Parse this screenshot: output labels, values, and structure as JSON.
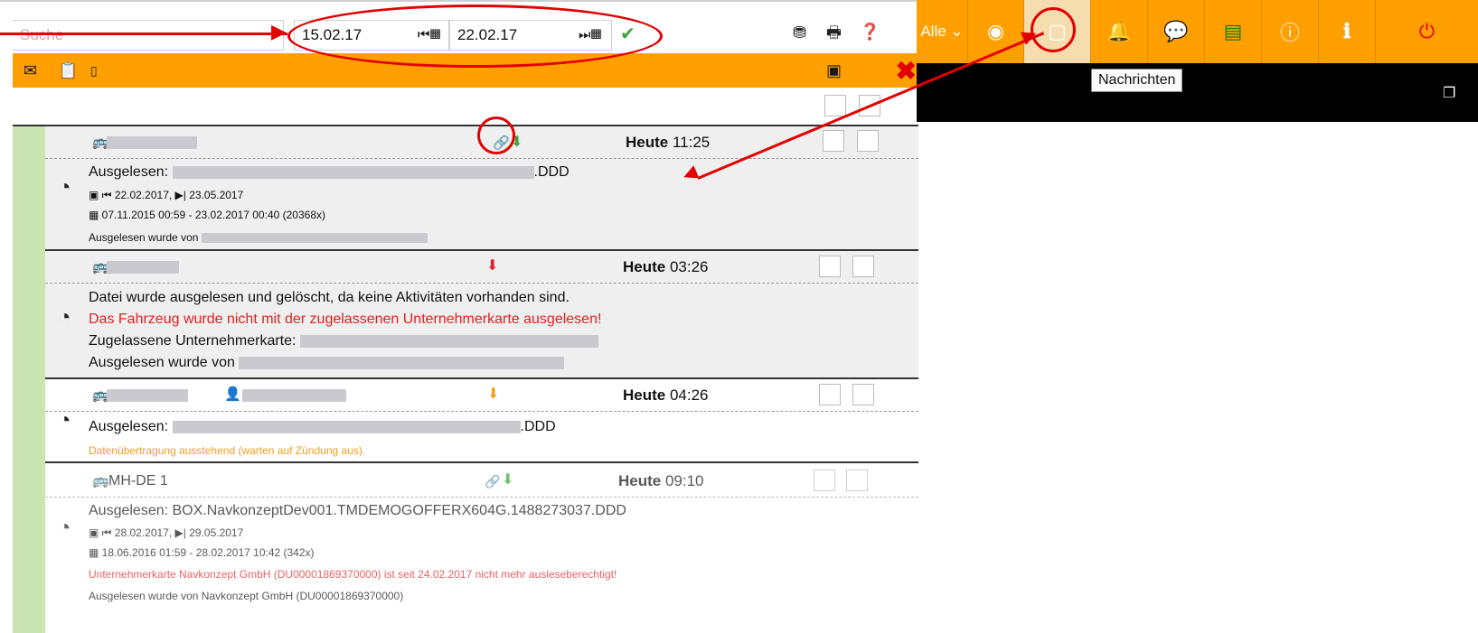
{
  "toolbar": {
    "search_placeholder": "Suche",
    "date_from": "15.02.17",
    "date_to": "22.02.17",
    "icons": [
      "first-page-calendar-icon",
      "last-page-calendar-icon",
      "checkmark-icon",
      "filter-icon",
      "print-icon",
      "help-icon"
    ]
  },
  "actionbar": {
    "icons": [
      "email-icon",
      "clipboard-icon",
      "mobile-icon",
      "archive-icon",
      "close-icon"
    ],
    "close_glyph": "✖"
  },
  "appbar": {
    "filter_label": "Alle ⌄",
    "tooltip": "Nachrichten",
    "cells": [
      "globe-icon",
      "messages-icon",
      "bell-icon",
      "chat-icon",
      "card-icon",
      "help-circle-icon",
      "info-icon",
      "power-icon"
    ]
  },
  "messages": [
    {
      "time_prefix": "Heute",
      "time": "11:25",
      "line1_prefix": "Ausgelesen:",
      "line1_suffix": ".DDD",
      "line2": "22.02.2017, ▶| 23.05.2017",
      "line3": "07.11.2015 00:59 - 23.02.2017 00:40 (20368x)",
      "line4_prefix": "Ausgelesen wurde von"
    },
    {
      "time_prefix": "Heute",
      "time": "03:26",
      "line1": "Datei wurde ausgelesen und gelöscht, da keine Aktivitäten vorhanden sind.",
      "line2": "Das Fahrzeug wurde nicht mit der zugelassenen Unternehmerkarte ausgelesen!",
      "line3_prefix": "Zugelassene Unternehmerkarte:",
      "line4_prefix": "Ausgelesen wurde von"
    },
    {
      "time_prefix": "Heute",
      "time": "04:26",
      "line1_prefix": "Ausgelesen:",
      "line1_suffix": ".DDD",
      "line2": "Datenübertragung ausstehend (warten auf Zündung aus)."
    },
    {
      "vehicle": "MH-DE 1",
      "time_prefix": "Heute",
      "time": "09:10",
      "line1": "Ausgelesen: BOX.NavkonzeptDev001.TMDEMOGOFFERX604G.1488273037.DDD",
      "line2": "28.02.2017, ▶| 29.05.2017",
      "line3": "18.06.2016 01:59 - 28.02.2017 10:42 (342x)",
      "line4": "Unternehmerkarte Navkonzept GmbH (DU00001869370000) ist seit 24.02.2017 nicht mehr ausleseberechtigt!",
      "line5": "Ausgelesen wurde von Navkonzept GmbH (DU00001869370000)"
    }
  ],
  "colors": {
    "accent_orange": "#ffa000",
    "annotation_red": "#e20000",
    "status_green": "#c9e3b3",
    "warning_red": "#e02020",
    "pending_orange": "#f0a020"
  }
}
